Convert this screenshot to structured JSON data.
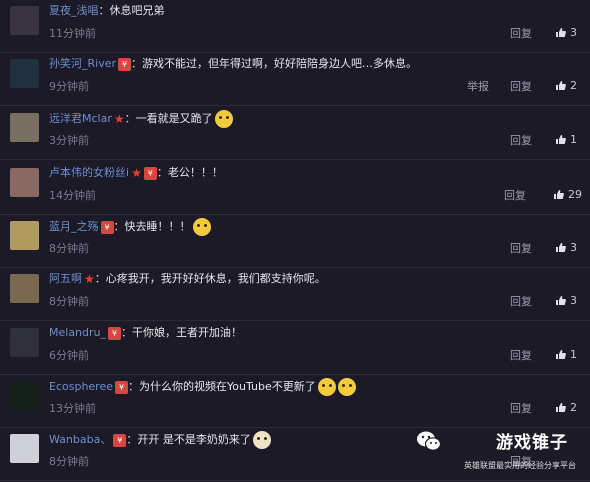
{
  "comments": [
    {
      "username": "夏夜_浅唱",
      "badge": false,
      "star": false,
      "text": "休息吧兄弟",
      "emoji": "",
      "time": "11分钟前",
      "report": "",
      "reply": "回复",
      "likes": "3",
      "avatar_color": "#3a3340"
    },
    {
      "username": "孙笑河_River",
      "badge": true,
      "star": false,
      "text": "游戏不能过，但年得过啊，好好陪陪身边人吧…多休息。",
      "emoji": "",
      "time": "9分钟前",
      "report": "举报",
      "reply": "回复",
      "likes": "2",
      "avatar_color": "#1f3140"
    },
    {
      "username": "远洋君Mclar",
      "badge": false,
      "star": true,
      "text": "一看就是又跪了",
      "emoji": "doge",
      "time": "3分钟前",
      "report": "",
      "reply": "回复",
      "likes": "1",
      "avatar_color": "#7a7060"
    },
    {
      "username": "卢本伟的女粉丝i",
      "badge": true,
      "star": true,
      "text": "老公！！！",
      "emoji": "",
      "time": "14分钟前",
      "report": "",
      "reply": "回复",
      "likes": "29",
      "avatar_color": "#8a6a60"
    },
    {
      "username": "蓝月_之殇",
      "badge": true,
      "star": false,
      "text": "快去睡！！！",
      "emoji": "face",
      "time": "8分钟前",
      "report": "",
      "reply": "回复",
      "likes": "3",
      "avatar_color": "#b09a60"
    },
    {
      "username": "阿五啊",
      "badge": false,
      "star": true,
      "text": "心疼我开，我开好好休息，我们都支持你呢。",
      "emoji": "",
      "time": "8分钟前",
      "report": "",
      "reply": "回复",
      "likes": "3",
      "avatar_color": "#7a6850"
    },
    {
      "username": "Melandru_",
      "badge": true,
      "star": false,
      "text": "干你娘，王者开加油！",
      "emoji": "",
      "time": "6分钟前",
      "report": "",
      "reply": "回复",
      "likes": "1",
      "avatar_color": "#30303c"
    },
    {
      "username": "Ecospheree",
      "badge": true,
      "star": false,
      "text": "为什么你的视频在YouTube不更新了",
      "emoji": "cry",
      "time": "13分钟前",
      "report": "",
      "reply": "回复",
      "likes": "2",
      "avatar_color": "#142018"
    },
    {
      "username": "Wanbaba、",
      "badge": true,
      "star": false,
      "text": "开开 是不是李奶奶来了",
      "emoji": "dog",
      "time": "8分钟前",
      "report": "",
      "reply": "回复",
      "likes": "",
      "avatar_color": "#d0d0d8"
    }
  ],
  "badge_label": "¥",
  "watermark": {
    "name": "游戏锥子",
    "sub": "英雄联盟最实用的经验分享平台"
  },
  "colors": {
    "background": "#1b1a26",
    "username": "#6f8fcf",
    "badge": "#d8473f",
    "star": "#e8402f"
  }
}
